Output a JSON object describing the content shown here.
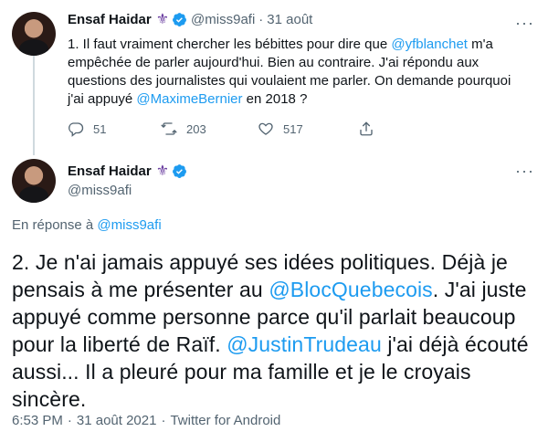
{
  "tweet1": {
    "name": "Ensaf Haidar",
    "handle": "@miss9afi",
    "dot": "·",
    "date": "31 août",
    "text_parts": [
      "1. Il faut vraiment chercher les bébittes pour dire que ",
      "@yfblanchet",
      "  m'a empêchée de parler aujourd'hui. Bien au contraire. J'ai répondu aux questions des journalistes qui voulaient me parler. On demande pourquoi j'ai appuyé ",
      "@MaximeBernier",
      " en 2018 ?"
    ],
    "reply_count": "51",
    "retweet_count": "203",
    "like_count": "517"
  },
  "tweet2": {
    "name": "Ensaf Haidar",
    "handle": "@miss9afi",
    "reply_prefix": "En réponse à ",
    "reply_to": "@miss9afi",
    "text_parts": [
      "2. Je n'ai jamais appuyé ses idées politiques. Déjà je pensais à me présenter au ",
      "@BlocQuebecois",
      ". J'ai juste appuyé comme personne parce qu'il parlait beaucoup pour la liberté de Raïf. ",
      "@JustinTrudeau",
      " j'ai déjà écouté aussi... Il a pleuré pour ma famille et je le croyais sincère."
    ],
    "time": "6:53 PM",
    "date": "31 août 2021",
    "source": "Twitter for Android",
    "sep": "·"
  },
  "colors": {
    "accent": "#1d9bf0",
    "text": "#0f1419",
    "secondary": "#536471",
    "thread_line": "#cfd9de",
    "fleur": "#6b3fa0"
  },
  "icons": {
    "fleur": "⚜",
    "more": "···"
  }
}
